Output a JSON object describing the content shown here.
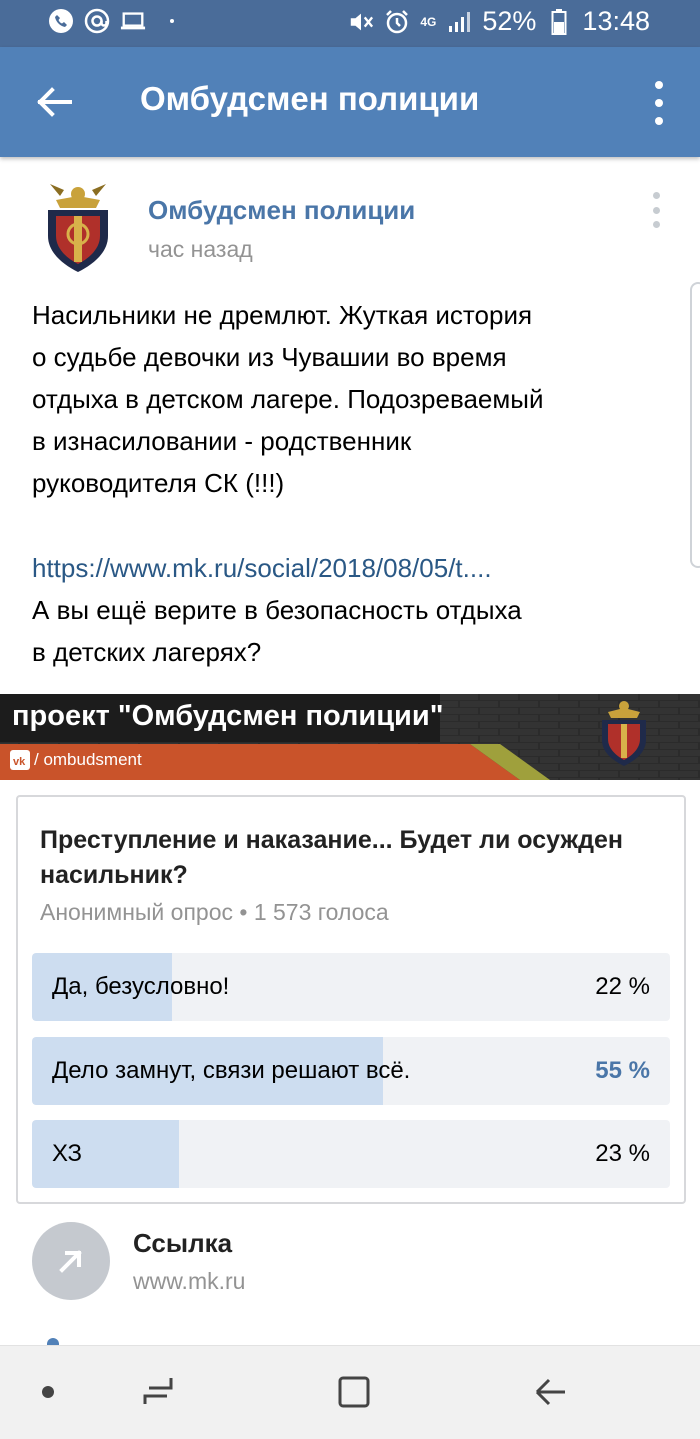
{
  "status_bar": {
    "battery": "52%",
    "time": "13:48",
    "network": "4G"
  },
  "app_bar": {
    "title": "Омбудсмен полиции"
  },
  "post": {
    "author": "Омбудсмен полиции",
    "time": "час назад",
    "text_lines": [
      "Насильники не дремлют. Жуткая история",
      "о судьбе девочки из Чувашии во время",
      "отдыха в детском лагере. Подозреваемый",
      "в изнасиловании - родственник",
      "руководителя СК (!!!)"
    ],
    "link": "https://www.mk.ru/social/2018/08/05/t....",
    "text_after_lines": [
      "А вы ещё верите в безопасность отдыха",
      "в детских лагерях?"
    ]
  },
  "banner": {
    "title": "проект \"Омбудсмен полиции\"",
    "handle": "/ ombudsment"
  },
  "poll": {
    "question": "Преступление и наказание... Будет ли осужден насильник?",
    "meta": "Анонимный опрос • 1 573 голоса",
    "options": [
      {
        "label": "Да, безусловно!",
        "percent_text": "22 %",
        "share": 0.22,
        "highlight": false
      },
      {
        "label": "Дело замнут, связи решают всё.",
        "percent_text": "55 %",
        "share": 0.55,
        "highlight": true
      },
      {
        "label": "ХЗ",
        "percent_text": "23 %",
        "share": 0.23,
        "highlight": false
      }
    ]
  },
  "link_attachment": {
    "title": "Ссылка",
    "url": "www.mk.ru"
  },
  "colors": {
    "status_bar": "#4a6c99",
    "app_bar": "#5181b8",
    "link": "#2a5885",
    "poll_fill": "#cdddf0",
    "poll_track": "#f0f2f5"
  }
}
